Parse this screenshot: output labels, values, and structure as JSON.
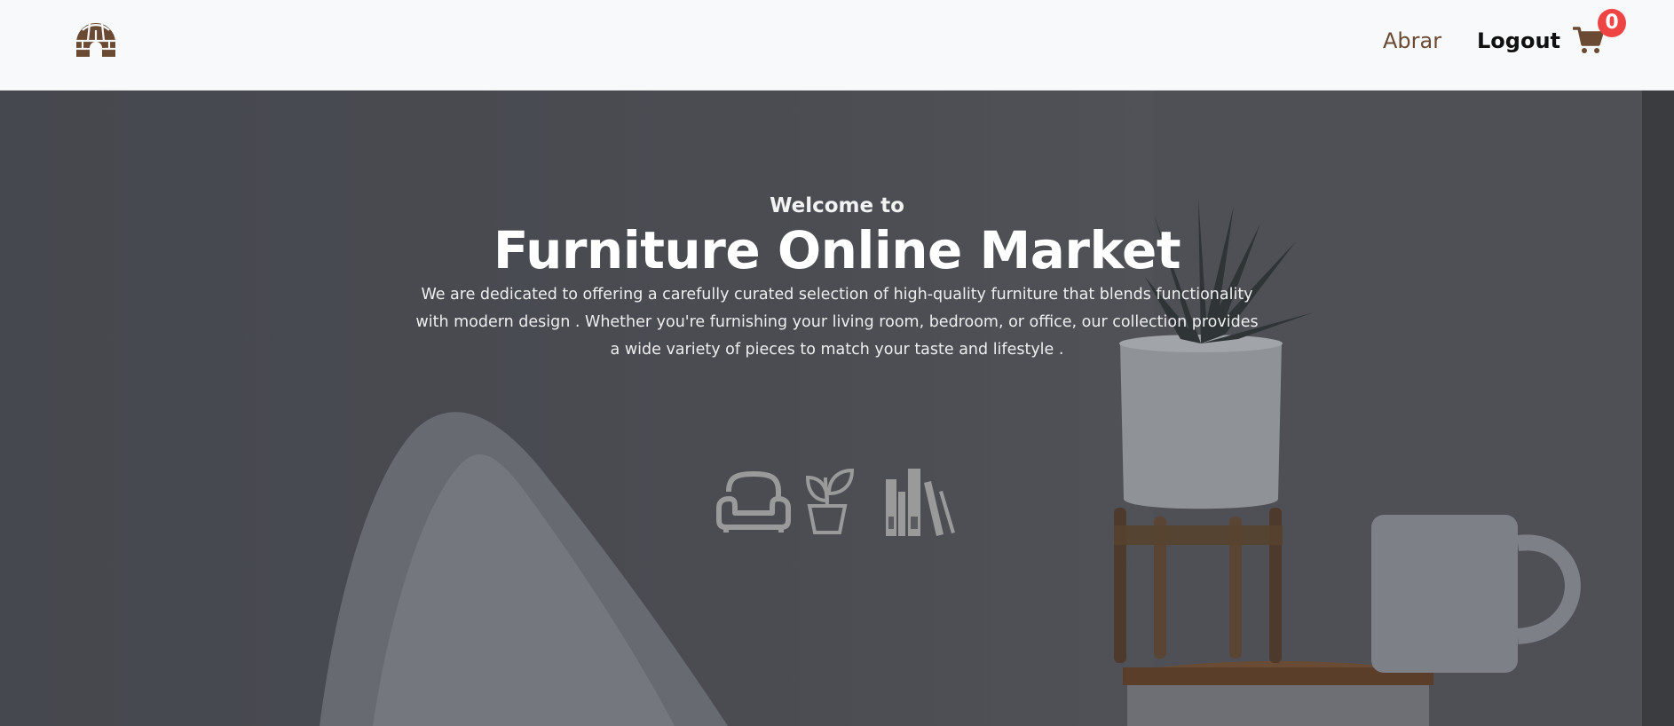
{
  "navbar": {
    "logo_icon": "igloo-icon",
    "user_link": "Abrar",
    "logout_link": "Logout",
    "cart_icon": "shopping-cart-icon",
    "cart_count": "0"
  },
  "hero": {
    "welcome": "Welcome to",
    "title": "Furniture Online Market",
    "description": "We are dedicated to offering a carefully curated selection of high-quality furniture that blends functionality with modern design . Whether you're furnishing your living room, bedroom, or office, our collection provides a wide variety of pieces to match your taste and lifestyle .",
    "icons": [
      "armchair-icon",
      "plant-icon",
      "books-icon"
    ]
  },
  "colors": {
    "brand_brown": "#6b4a33",
    "badge_red": "#ee4444",
    "navbar_bg": "#f8f9fb",
    "hero_overlay": "#4a4c52"
  }
}
